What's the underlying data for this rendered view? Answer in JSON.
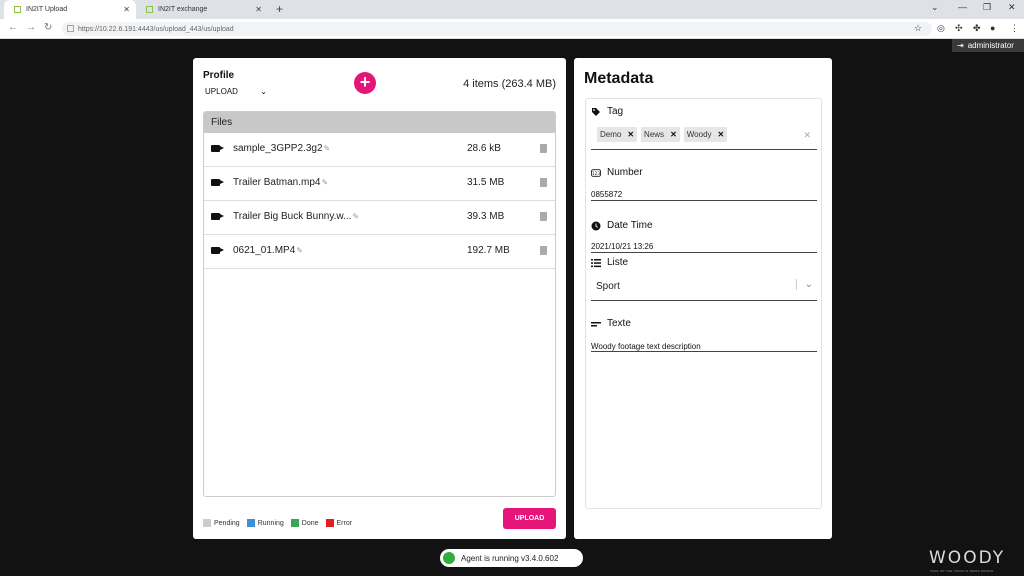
{
  "browser": {
    "tabs": [
      {
        "title": "IN2IT Upload",
        "active": true
      },
      {
        "title": "IN2IT exchange",
        "active": false
      }
    ],
    "url": "https://10.22.6.191:4443/us/upload_443/us/upload"
  },
  "user": {
    "name": "administrator"
  },
  "left": {
    "profile_label": "Profile",
    "profile_value": "UPLOAD",
    "items_count": "4 items (263.4 MB)",
    "files_header": "Files",
    "files": [
      {
        "name": "sample_3GPP2.3g2",
        "size": "28.6 kB"
      },
      {
        "name": "Trailer Batman.mp4",
        "size": "31.5 MB"
      },
      {
        "name": "Trailer Big Buck Bunny.w...",
        "size": "39.3 MB"
      },
      {
        "name": "0621_01.MP4",
        "size": "192.7 MB"
      }
    ],
    "legend": [
      {
        "label": "Pending",
        "color": "#cccccc"
      },
      {
        "label": "Running",
        "color": "#3b8fd4"
      },
      {
        "label": "Done",
        "color": "#3aa65a"
      },
      {
        "label": "Error",
        "color": "#e02020"
      }
    ],
    "upload_label": "UPLOAD"
  },
  "metadata": {
    "title": "Metadata",
    "tag_label": "Tag",
    "tags": [
      "Demo",
      "News",
      "Woody"
    ],
    "number_label": "Number",
    "number_value": "0855872",
    "datetime_label": "Date Time",
    "datetime_value": "2021/10/21 13:26",
    "liste_label": "Liste",
    "liste_value": "Sport",
    "texte_label": "Texte",
    "texte_value": "Woody footage text description"
  },
  "footer": {
    "agent_status": "Agent is running v3.4.0.602",
    "logo": "WOODY",
    "logo_tagline": "TAKE UP THE TODAY'S NEWS WORLD"
  },
  "colors": {
    "accent": "#e5157a",
    "status_ok": "#2eae3a"
  }
}
